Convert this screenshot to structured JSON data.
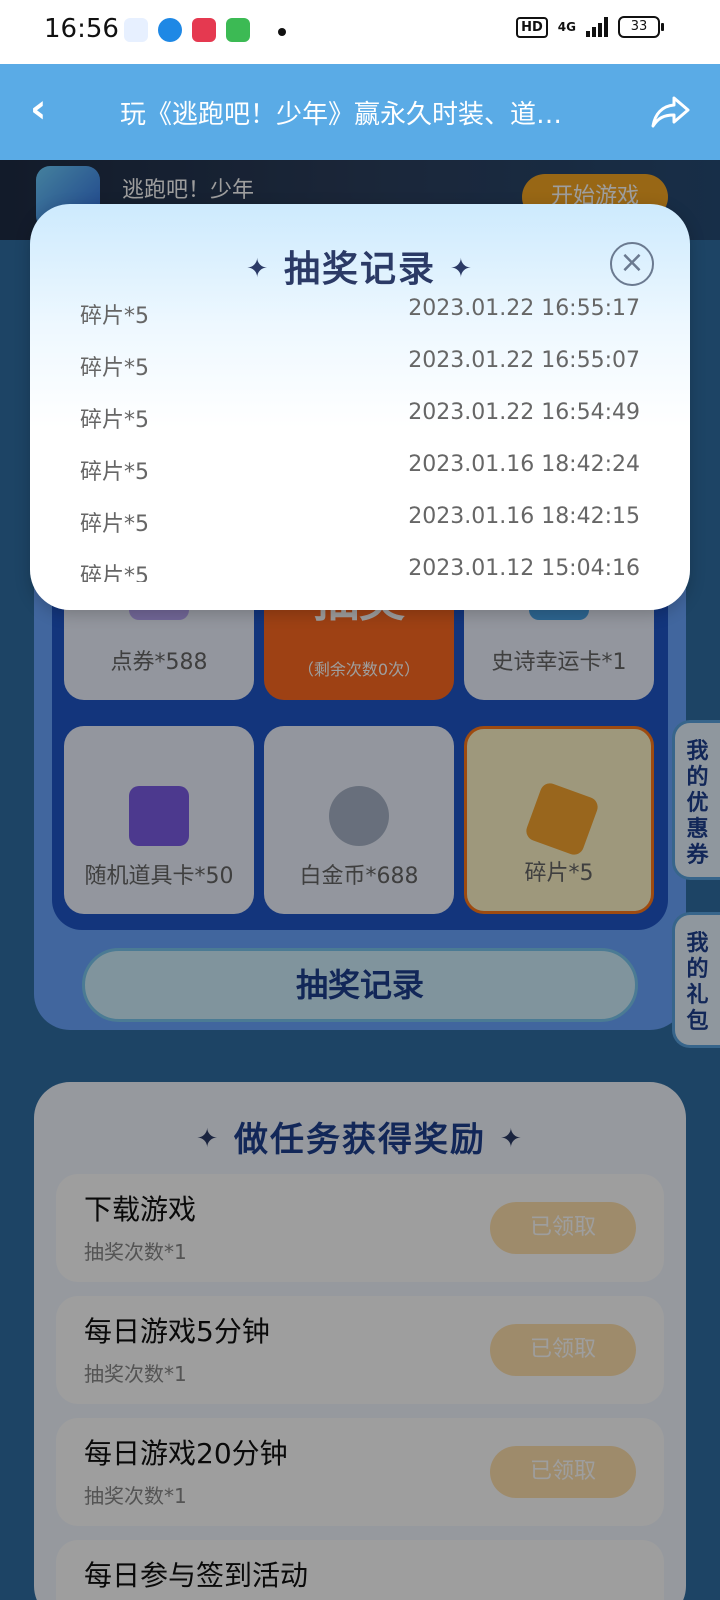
{
  "status_bar": {
    "time": "16:56",
    "hd_badge": "HD",
    "network": "4G",
    "battery": "33"
  },
  "header": {
    "back_icon": "chevron-left",
    "title": "玩《逃跑吧！少年》赢永久时装、道…",
    "share_icon": "share-arrow"
  },
  "game_banner": {
    "name": "逃跑吧！少年",
    "start_label": "开始游戏"
  },
  "prize_grid": {
    "center": {
      "label": "抽奖",
      "remaining": "（剩余次数0次）"
    },
    "items": [
      {
        "label": "点券*588"
      },
      {
        "label": "史诗幸运卡*1"
      },
      {
        "label": "随机道具卡*50"
      },
      {
        "label": "白金币*688"
      },
      {
        "label": "碎片*5",
        "selected": true
      }
    ]
  },
  "record_button_label": "抽奖记录",
  "side_tabs": {
    "coupons": "我的优惠券",
    "gifts": "我的礼包"
  },
  "tasks": {
    "title": "做任务获得奖励",
    "items": [
      {
        "name": "下载游戏",
        "reward": "抽奖次数*1",
        "button": "已领取"
      },
      {
        "name": "每日游戏5分钟",
        "reward": "抽奖次数*1",
        "button": "已领取"
      },
      {
        "name": "每日游戏20分钟",
        "reward": "抽奖次数*1",
        "button": "已领取"
      },
      {
        "name": "每日参与签到活动",
        "reward": "",
        "button": ""
      }
    ]
  },
  "modal": {
    "title": "抽奖记录",
    "close_icon": "close-circle",
    "records": [
      {
        "item": "碎片*5",
        "time": "2023.01.22 16:55:17"
      },
      {
        "item": "碎片*5",
        "time": "2023.01.22 16:55:07"
      },
      {
        "item": "碎片*5",
        "time": "2023.01.22 16:54:49"
      },
      {
        "item": "碎片*5",
        "time": "2023.01.16 18:42:24"
      },
      {
        "item": "碎片*5",
        "time": "2023.01.16 18:42:15"
      },
      {
        "item": "碎片*5",
        "time": "2023.01.12 15:04:16"
      }
    ]
  }
}
